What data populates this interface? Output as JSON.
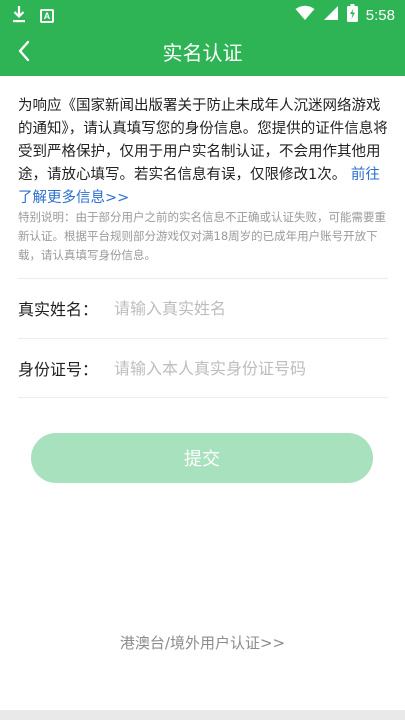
{
  "status_bar": {
    "time": "5:58",
    "icons": [
      "download-icon",
      "app-a-icon",
      "wifi-icon",
      "signal-icon",
      "battery-charging-icon"
    ],
    "badge_letter": "A"
  },
  "header": {
    "title": "实名认证",
    "back_icon": "chevron-left-icon"
  },
  "notice": {
    "text": "为响应《国家新闻出版署关于防止未成年人沉迷网络游戏的通知》，请认真填写您的身份信息。您提供的证件信息将受到严格保护，仅用于用户实名制认证，不会用作其他用途，请放心填写。若实名信息有误，仅限修改1次。 ",
    "link": "前往了解更多信息>>"
  },
  "special_note": "特别说明：由于部分用户之前的实名信息不正确或认证失败，可能需要重新认证。根据平台规则部分游戏仅对满18周岁的已成年用户账号开放下载，请认真填写身份信息。",
  "form": {
    "name_label": "真实姓名：",
    "name_placeholder": "请输入真实姓名",
    "name_value": "",
    "id_label": "身份证号：",
    "id_placeholder": "请输入本人真实身份证号码",
    "id_value": ""
  },
  "submit_label": "提交",
  "overseas_link": "港澳台/境外用户认证>>",
  "colors": {
    "primary": "#2fb455",
    "submit_disabled": "#a8e1bd",
    "link": "#2b6fd0",
    "muted": "#9a9a9a"
  }
}
